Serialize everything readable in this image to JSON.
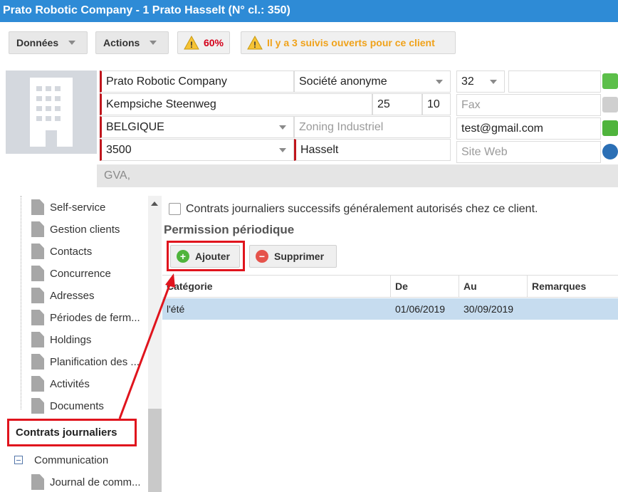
{
  "window": {
    "title": "Prato Robotic Company - 1 Prato Hasselt (N° cl.: 350)"
  },
  "toolbar": {
    "donnees_label": "Données",
    "actions_label": "Actions",
    "percent_label": "60%",
    "notice_label": "Il y a 3 suivis ouverts pour ce client"
  },
  "client": {
    "name": "Prato Robotic Company",
    "legal_form": "Société anonyme",
    "street": "Kempsiche Steenweg",
    "house_number": "25",
    "box": "10",
    "country": "BELGIQUE",
    "zoning_placeholder": "Zoning Industriel",
    "postal_code": "3500",
    "city": "Hasselt",
    "phone_prefix": "32",
    "phone": "",
    "fax_placeholder": "Fax",
    "email": "test@gmail.com",
    "website_placeholder": "Site Web",
    "note": "GVA,"
  },
  "sidebar": {
    "items": [
      {
        "label": "Self-service"
      },
      {
        "label": "Gestion clients"
      },
      {
        "label": "Contacts"
      },
      {
        "label": "Concurrence"
      },
      {
        "label": "Adresses"
      },
      {
        "label": "Périodes de ferm..."
      },
      {
        "label": "Holdings"
      },
      {
        "label": "Planification des ..."
      },
      {
        "label": "Activités"
      },
      {
        "label": "Documents"
      }
    ],
    "selected": "Contrats journaliers",
    "communication": "Communication",
    "journal": "Journal de comm..."
  },
  "main": {
    "checkbox_label": "Contrats journaliers successifs généralement autorisés chez ce client.",
    "section_title": "Permission périodique",
    "add_label": "Ajouter",
    "delete_label": "Supprimer",
    "columns": [
      "Catégorie",
      "De",
      "Au",
      "Remarques"
    ],
    "rows": [
      {
        "categorie": "l'été",
        "de": "01/06/2019",
        "au": "30/09/2019",
        "remarques": ""
      }
    ]
  },
  "colors": {
    "titlebar": "#2e8bd6",
    "highlight": "#e0141d",
    "selected_row": "#c6dcef",
    "required": "#c0161d"
  }
}
